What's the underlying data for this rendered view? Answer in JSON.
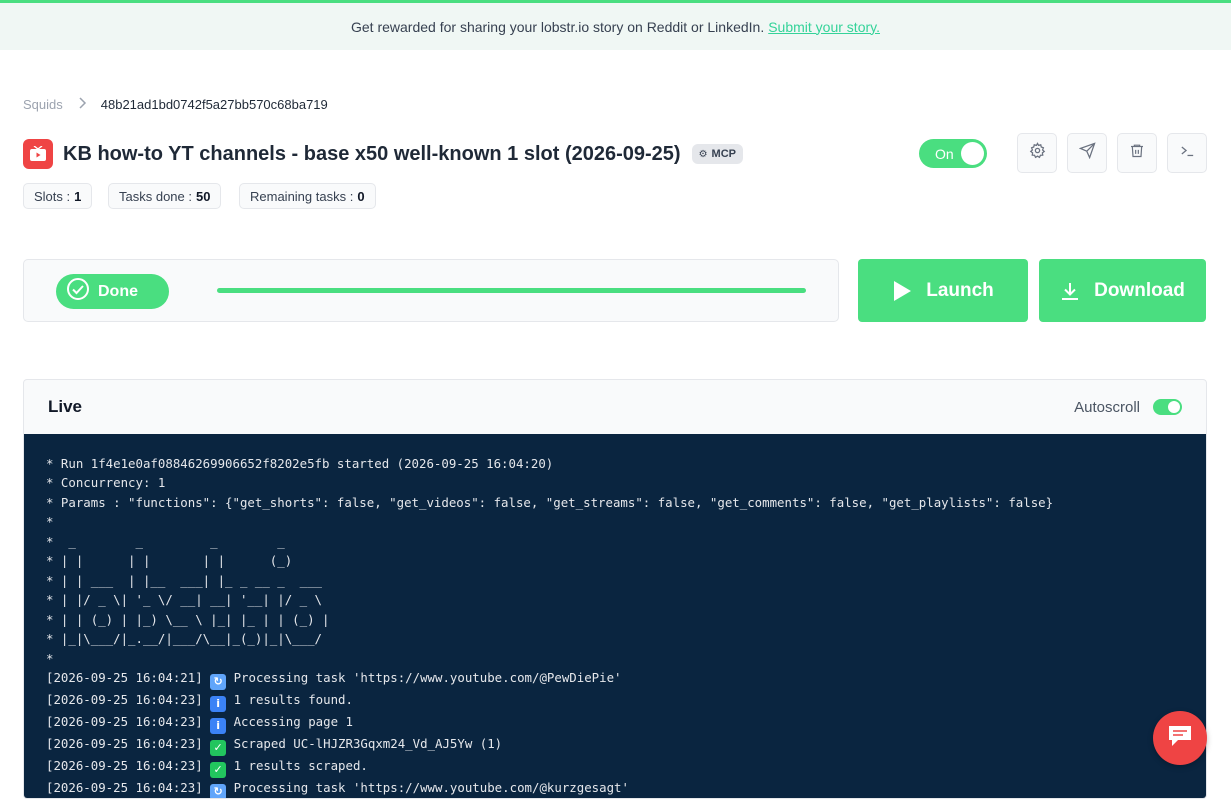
{
  "banner": {
    "text": "Get rewarded for sharing your lobstr.io story on Reddit or LinkedIn.",
    "link": "Submit your story."
  },
  "breadcrumb": {
    "root": "Squids",
    "current": "48b21ad1bd0742f5a27bb570c68ba719"
  },
  "squid": {
    "title": "KB how-to YT channels - base x50 well-known 1 slot (2026-09-25)",
    "badge": "MCP",
    "toggle_label": "On"
  },
  "stats": {
    "slots_label": "Slots :",
    "slots_value": "1",
    "done_label": "Tasks done :",
    "done_value": "50",
    "remaining_label": "Remaining tasks :",
    "remaining_value": "0"
  },
  "run": {
    "status": "Done",
    "progress": 1.0
  },
  "actions": {
    "launch": "Launch",
    "download": "Download"
  },
  "live": {
    "title": "Live",
    "autoscroll": "Autoscroll",
    "header_lines": [
      "* Run 1f4e1e0af08846269906652f8202e5fb started (2026-09-25 16:04:20)",
      "* Concurrency: 1",
      "* Params : \"functions\": {\"get_shorts\": false, \"get_videos\": false, \"get_streams\": false, \"get_comments\": false, \"get_playlists\": false}",
      "*",
      "*  _        _         _        _",
      "* | |      | |       | |      (_)",
      "* | | ___  | |__  ___| |_ _ __ _  ___",
      "* | |/ _ \\| '_ \\/ __| __| '__| |/ _ \\",
      "* | | (_) | |_) \\__ \\ |_| |_ | | (_) |",
      "* |_|\\___/|_.__/|___/\\__|_(_)|_|\\___/",
      "*"
    ],
    "log": [
      {
        "ts": "[2026-09-25 16:04:21]",
        "icon": "processing-icon",
        "text": "Processing task 'https://www.youtube.com/@PewDiePie'"
      },
      {
        "ts": "[2026-09-25 16:04:23]",
        "icon": "info-icon",
        "text": "1 results found."
      },
      {
        "ts": "[2026-09-25 16:04:23]",
        "icon": "info-icon",
        "text": "Accessing page 1"
      },
      {
        "ts": "[2026-09-25 16:04:23]",
        "icon": "check-icon",
        "text": "Scraped UC-lHJZR3Gqxm24_Vd_AJ5Yw (1)"
      },
      {
        "ts": "[2026-09-25 16:04:23]",
        "icon": "check-icon",
        "text": "1 results scraped."
      },
      {
        "ts": "[2026-09-25 16:04:23]",
        "icon": "processing-icon",
        "text": "Processing task 'https://www.youtube.com/@kurzgesagt'"
      }
    ]
  },
  "colors": {
    "accent": "#4ade80",
    "console_bg": "#0a2540",
    "youtube": "#ef4444"
  }
}
